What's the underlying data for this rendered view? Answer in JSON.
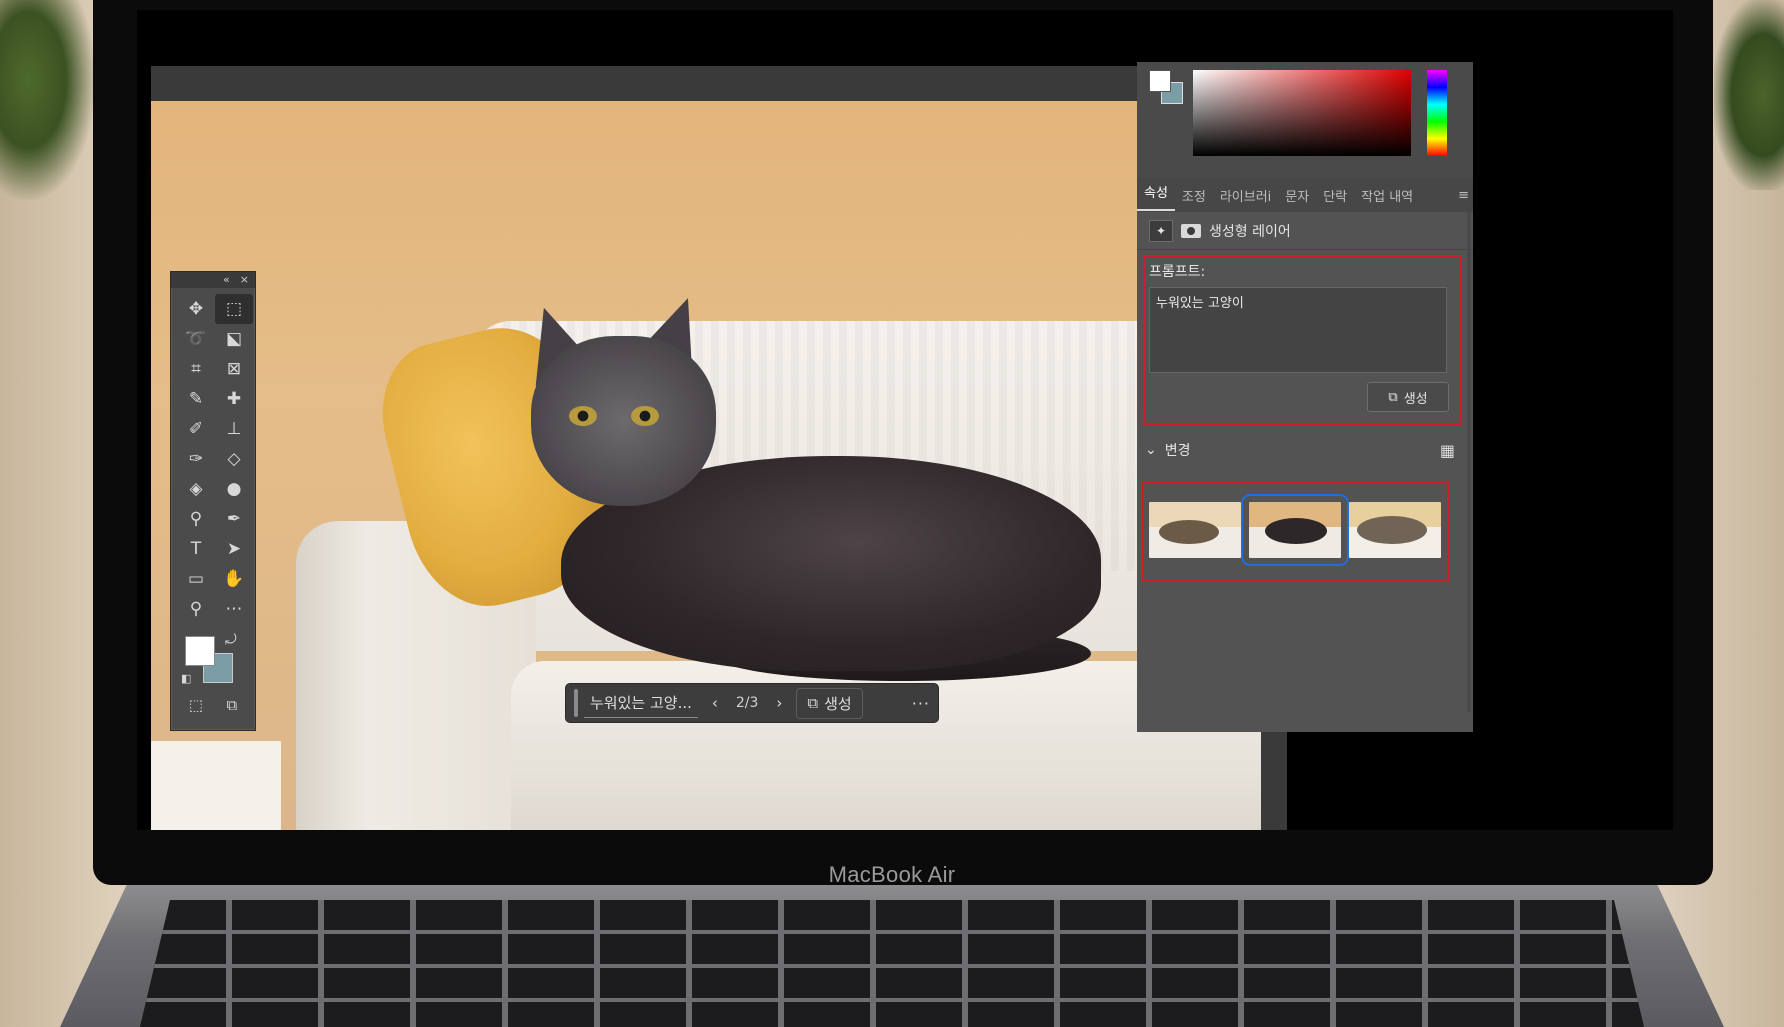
{
  "laptop": {
    "brand": "MacBook Air"
  },
  "tools_panel": {
    "collapse_glyph": "«",
    "close_glyph": "×",
    "tools": [
      "move-tool-icon",
      "marquee-tool-icon",
      "lasso-tool-icon",
      "object-select-tool-icon",
      "crop-tool-icon",
      "frame-tool-icon",
      "eyedropper-tool-icon",
      "healing-brush-icon",
      "brush-tool-icon",
      "clone-stamp-icon",
      "history-brush-icon",
      "eraser-tool-icon",
      "paint-bucket-icon",
      "blur-tool-icon",
      "dodge-tool-icon",
      "pen-tool-icon",
      "type-tool-icon",
      "path-select-icon",
      "rectangle-tool-icon",
      "hand-tool-icon",
      "zoom-tool-icon",
      "more-tools-icon"
    ],
    "foreground_color": "#ffffff",
    "background_color": "#7b9ea6"
  },
  "taskbar": {
    "prompt": "누워있는 고양...",
    "counter": "2/3",
    "generate_label": "생성"
  },
  "right_panel": {
    "tabs": [
      "속성",
      "조정",
      "라이브러i",
      "문자",
      "단락",
      "작업 내역"
    ],
    "layer_name": "생성형 레이어",
    "prompt_label": "프롬프트:",
    "prompt_value": "누워있는 고양이",
    "generate_label": "생성",
    "variations_label": "변경",
    "variations_selected": 2,
    "variations_count": 3
  },
  "colors": {
    "highlight_red": "#cf1f26",
    "selection_blue": "#1d6fe0",
    "panel_bg": "#535353"
  }
}
